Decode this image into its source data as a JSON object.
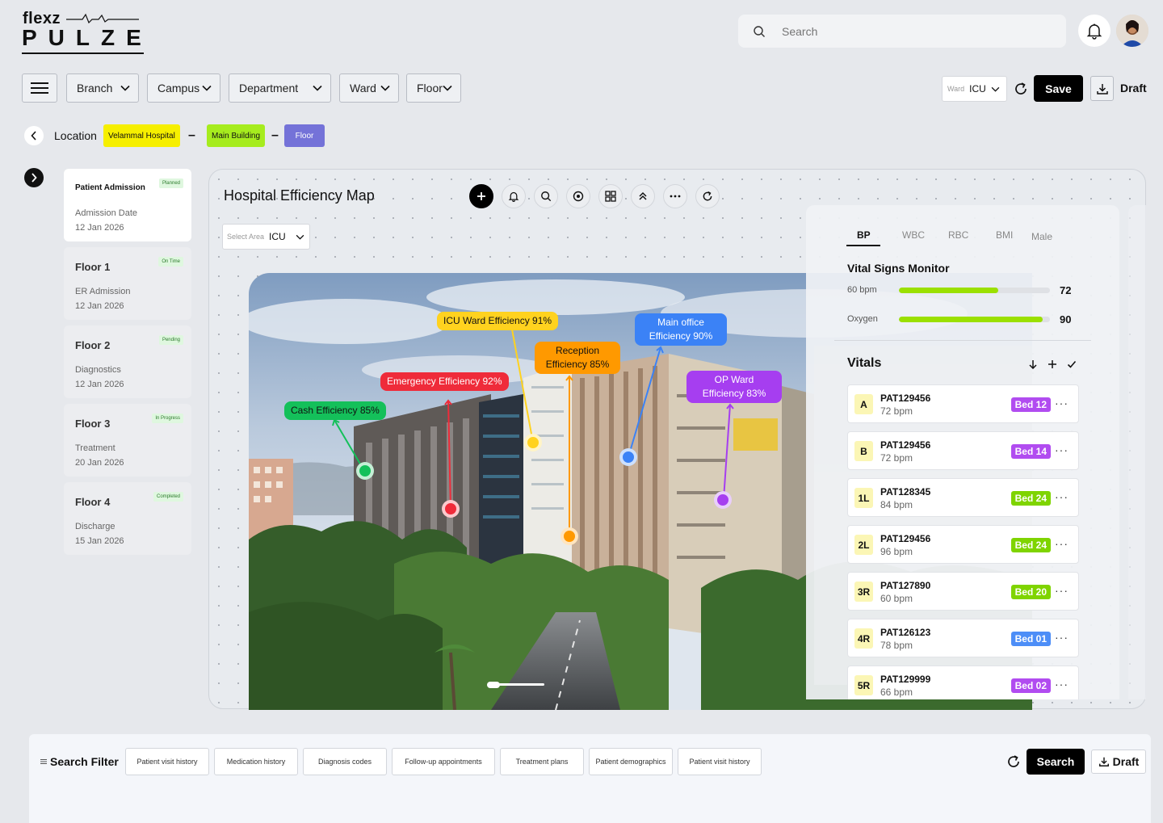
{
  "brand": {
    "top": "flexz",
    "main": "PULZE"
  },
  "header": {
    "search_placeholder": "Search"
  },
  "filters": {
    "branch": "Branch",
    "campus": "Campus",
    "department": "Department",
    "ward": "Ward",
    "floor": "Floor"
  },
  "toolbar": {
    "ward_label": "Ward",
    "ward_value": "ICU",
    "save": "Save",
    "draft": "Draft"
  },
  "breadcrumb": {
    "label": "Location",
    "hospital": "Velammal Hospital",
    "building": "Main Building",
    "floor": "Floor"
  },
  "floors": [
    {
      "title": "Patient Admission",
      "badge": "Planned",
      "sub": "Admission Date",
      "date": "12 Jan 2026"
    },
    {
      "title": "Floor 1",
      "badge": "On Time",
      "sub": "ER Admission",
      "date": "12 Jan 2026"
    },
    {
      "title": "Floor 2",
      "badge": "Pending",
      "sub": "Diagnostics",
      "date": "12 Jan 2026"
    },
    {
      "title": "Floor 3",
      "badge": "In Progress",
      "sub": "Treatment",
      "date": "20 Jan 2026"
    },
    {
      "title": "Floor 4",
      "badge": "Completed",
      "sub": "Discharge",
      "date": "15 Jan 2026"
    }
  ],
  "map": {
    "title": "Hospital Efficiency Map",
    "area_label": "Select Area",
    "area_value": "ICU",
    "tags": {
      "icu": "ICU Ward Efficiency 91%",
      "main_office_l1": "Main office",
      "main_office_l2": "Efficiency 90%",
      "reception_l1": "Reception",
      "reception_l2": "Efficiency 85%",
      "emergency": "Emergency Efficiency 92%",
      "op_l1": "OP Ward",
      "op_l2": "Efficiency 83%",
      "cash": "Cash Efficiency 85%"
    },
    "colors": {
      "icu": "#ffd21f",
      "main_office": "#3b82f6",
      "reception": "#ff9900",
      "emergency": "#ef2b3a",
      "op": "#a63ef0",
      "cash": "#14c05a"
    }
  },
  "vitals_panel": {
    "tabs": [
      "BP",
      "WBC",
      "RBC",
      "BMI",
      "Male"
    ],
    "monitor_title": "Vital Signs Monitor",
    "bars": [
      {
        "label": "60 bpm",
        "value": "72",
        "fill_pct": 66
      },
      {
        "label": "Oxygen",
        "value": "90",
        "fill_pct": 95
      }
    ],
    "vitals_title": "Vitals",
    "patients": [
      {
        "code": "A",
        "id": "PAT129456",
        "bpm": "72 bpm",
        "bed": "Bed 12",
        "color": "#b14cf0"
      },
      {
        "code": "B",
        "id": "PAT129456",
        "bpm": "72 bpm",
        "bed": "Bed 14",
        "color": "#b14cf0"
      },
      {
        "code": "1L",
        "id": "PAT128345",
        "bpm": "84 bpm",
        "bed": "Bed 24",
        "color": "#7fd400"
      },
      {
        "code": "2L",
        "id": "PAT129456",
        "bpm": "96 bpm",
        "bed": "Bed 24",
        "color": "#7fd400"
      },
      {
        "code": "3R",
        "id": "PAT127890",
        "bpm": "60 bpm",
        "bed": "Bed 20",
        "color": "#7fd400"
      },
      {
        "code": "4R",
        "id": "PAT126123",
        "bpm": "78 bpm",
        "bed": "Bed 01",
        "color": "#4d8ef7"
      },
      {
        "code": "5R",
        "id": "PAT129999",
        "bpm": "66 bpm",
        "bed": "Bed 02",
        "color": "#b14cf0"
      }
    ]
  },
  "search_filter": {
    "label": "Search Filter",
    "chips": [
      "Patient visit history",
      "Medication history",
      "Diagnosis codes",
      "Follow-up appointments",
      "Treatment plans",
      "Patient demographics",
      "Patient visit history"
    ],
    "search": "Search",
    "draft": "Draft"
  }
}
